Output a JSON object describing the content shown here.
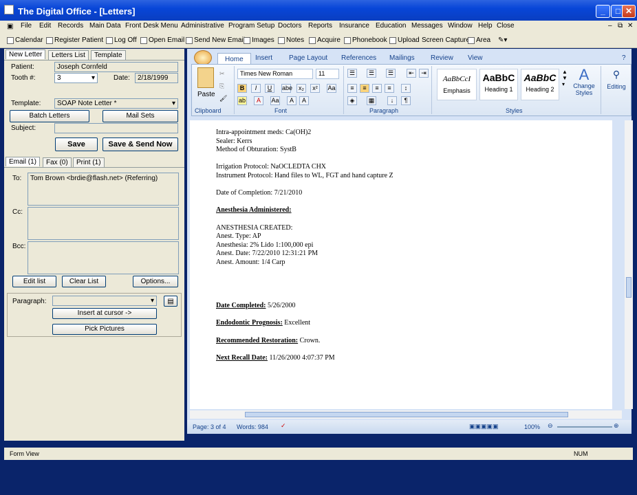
{
  "window": {
    "title": "The Digital Office - [Letters]"
  },
  "menu": [
    "File",
    "Edit",
    "Records",
    "Main Data",
    "Front Desk Menu",
    "Administrative",
    "Program Setup",
    "Doctors",
    "Reports",
    "Insurance",
    "Education",
    "Messages",
    "Window",
    "Help",
    "Close"
  ],
  "toolbar": [
    "Calendar",
    "Register Patient",
    "Log Off",
    "Open Email",
    "Send New Email",
    "Images",
    "Notes",
    "Acquire",
    "Phonebook",
    "Upload",
    "Screen Capture",
    "Area"
  ],
  "left": {
    "tabs": [
      "New Letter",
      "Letters List",
      "Template"
    ],
    "patient_label": "Patient:",
    "patient_value": "Joseph Cornfeld",
    "tooth_label": "Tooth #:",
    "tooth_value": "3",
    "date_label": "Date:",
    "date_value": "2/18/1999",
    "template_label": "Template:",
    "template_value": "SOAP Note Letter *",
    "batch_button": "Batch Letters",
    "mailsets_button": "Mail Sets",
    "subject_label": "Subject:",
    "subject_value": "",
    "save_button": "Save",
    "save_send_button": "Save & Send Now",
    "email_tabs": [
      "Email (1)",
      "Fax (0)",
      "Print (1)"
    ],
    "to_label": "To:",
    "to_value": "Tom Brown <brdie@flash.net> (Referring)",
    "cc_label": "Cc:",
    "bcc_label": "Bcc:",
    "edit_list_button": "Edit list",
    "clear_list_button": "Clear List",
    "options_button": "Options...",
    "paragraph_label": "Paragraph:",
    "insert_button": "Insert at cursor ->",
    "pick_pictures_button": "Pick Pictures"
  },
  "word": {
    "tabs": [
      "Home",
      "Insert",
      "Page Layout",
      "References",
      "Mailings",
      "Review",
      "View"
    ],
    "font_name": "Times New Roman",
    "font_size": "11",
    "groups": [
      "Clipboard",
      "Font",
      "Paragraph",
      "Styles",
      "Editing"
    ],
    "paste_label": "Paste",
    "styles": [
      "Emphasis",
      "Heading 1",
      "Heading 2"
    ],
    "style_preview": [
      "AaBbCcI",
      "AaBbC",
      "AaBbC"
    ],
    "change_styles": "Change Styles",
    "editing": "Editing",
    "doc_lines": [
      {
        "t": "Intra-appointment meds: Ca(OH)2",
        "b": false
      },
      {
        "t": "Sealer: Kerrs",
        "b": false
      },
      {
        "t": "Method of Obturation: SystB",
        "b": false
      },
      {
        "t": "",
        "b": false
      },
      {
        "t": "Irrigation Protocol: NaOCLEDTA  CHX",
        "b": false
      },
      {
        "t": "Instrument Protocol: Hand files to WL, FGT  and hand capture Z",
        "b": false
      },
      {
        "t": "",
        "b": false
      },
      {
        "t": "Date of Completion: 7/21/2010",
        "b": false
      },
      {
        "t": "",
        "b": false
      },
      {
        "t": "Anesthesia Administered:",
        "b": true
      },
      {
        "t": "",
        "b": false
      },
      {
        "t": "ANESTHESIA CREATED:",
        "b": false
      },
      {
        "t": "Anest. Type: AP",
        "b": false
      },
      {
        "t": "Anesthesia: 2% Lido 1:100,000 epi",
        "b": false
      },
      {
        "t": "Anest. Date: 7/22/2010 12:31:21 PM",
        "b": false
      },
      {
        "t": "Anest. Amount: 1/4 Carp",
        "b": false
      }
    ],
    "doc_fields": [
      {
        "label": "Date Completed:",
        "value": " 5/26/2000"
      },
      {
        "label": "Endodontic Prognosis:",
        "value": " Excellent"
      },
      {
        "label": "Recommended Restoration:",
        "value": " Crown."
      },
      {
        "label": "Next Recall Date:",
        "value": " 11/26/2000 4:07:37 PM"
      }
    ],
    "page": "Page: 3 of 4",
    "words": "Words: 984",
    "zoom": "100%"
  },
  "status": {
    "left": "Form View",
    "right": "NUM"
  }
}
